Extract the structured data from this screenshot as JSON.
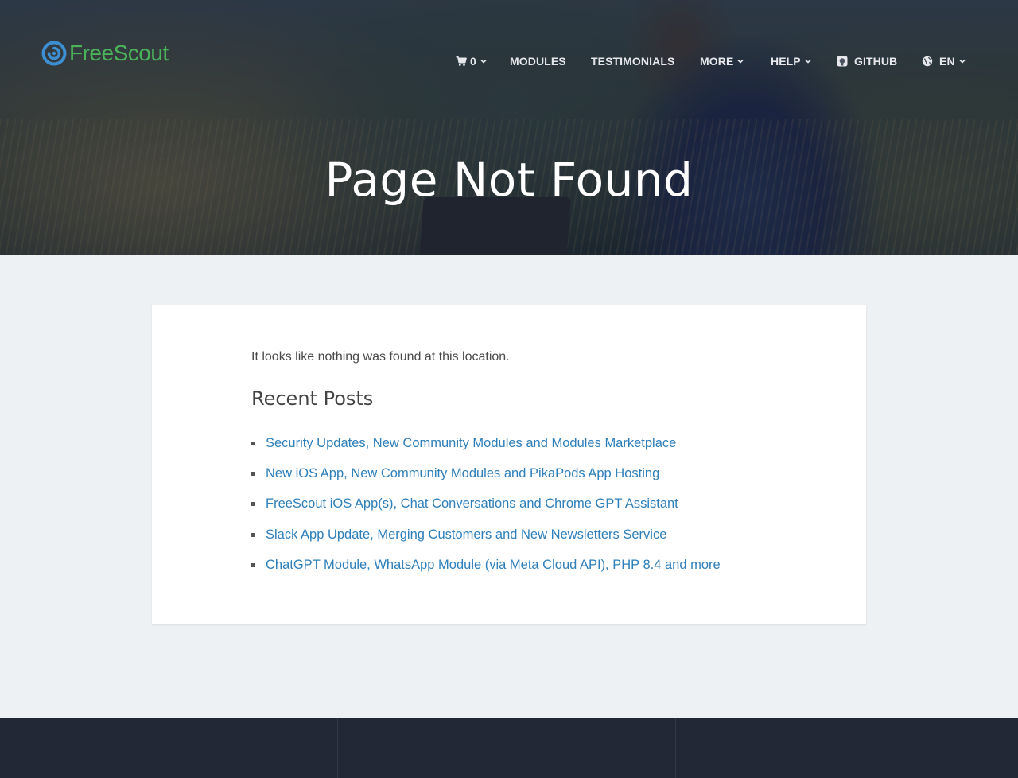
{
  "brand": {
    "name": "FreeScout",
    "logo_color": "#4bb35a",
    "mark_color": "#3d8fd1"
  },
  "nav": {
    "cart": {
      "icon": "cart-icon",
      "count": "0"
    },
    "items": [
      {
        "label": "MODULES",
        "dropdown": false
      },
      {
        "label": "TESTIMONIALS",
        "dropdown": false
      },
      {
        "label": "MORE",
        "dropdown": true
      },
      {
        "label": "HELP",
        "dropdown": true
      },
      {
        "label": "GITHUB",
        "icon": "github-icon",
        "dropdown": false
      },
      {
        "label": "EN",
        "icon": "globe-icon",
        "dropdown": true
      }
    ]
  },
  "hero": {
    "title": "Page Not Found"
  },
  "content": {
    "notice": "It looks like nothing was found at this location.",
    "recent_posts_title": "Recent Posts",
    "recent_posts": [
      "Security Updates, New Community Modules and Modules Marketplace",
      "New iOS App, New Community Modules and PikaPods App Hosting",
      "FreeScout iOS App(s), Chat Conversations and Chrome GPT Assistant",
      "Slack App Update, Merging Customers and New Newsletters Service",
      "ChatGPT Module, WhatsApp Module (via Meta Cloud API), PHP 8.4 and more"
    ]
  },
  "colors": {
    "link": "#2e7fba",
    "page_bg": "#edf1f4",
    "footer_bg": "#222835"
  }
}
